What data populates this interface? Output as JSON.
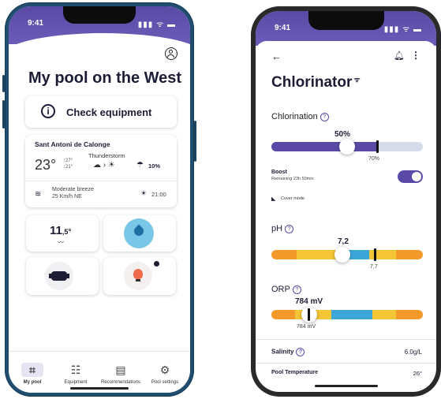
{
  "left_phone": {
    "status": {
      "time": "9:41",
      "icons": "▮▮▮ ᯤ ▬"
    },
    "pool_title": "My pool on the West",
    "check_equipment": "Check equipment",
    "weather": {
      "location": "Sant Antoni de Calonge",
      "temp": "23°",
      "temp_high": "↑27°",
      "temp_low": "↓21°",
      "condition": "Thunderstorm",
      "rain_chance": "10%",
      "wind_line1": "Moderate breeze",
      "wind_line2": "25 Km/h NE",
      "sunset": "21:00"
    },
    "tiles": {
      "water_temp_main": "11",
      "water_temp_dec": ",5",
      "water_temp_deg": "°"
    },
    "tabs": [
      {
        "label": "My pool",
        "icon": "pool-icon"
      },
      {
        "label": "Equipment",
        "icon": "equipment-icon"
      },
      {
        "label": "Recommendations",
        "icon": "recommendations-icon"
      },
      {
        "label": "Pool settings",
        "icon": "settings-icon"
      }
    ]
  },
  "right_phone": {
    "status": {
      "time": "9:41",
      "icons": "▮▮▮ ᯤ ▬"
    },
    "title": "Chlorinator",
    "chlorination": {
      "label": "Chlorination",
      "value": "50%",
      "target": "70%",
      "value_fraction": 0.5,
      "target_fraction": 0.7
    },
    "boost": {
      "label": "Boost",
      "remaining": "Remaining 23h 50min",
      "enabled": true
    },
    "cover_mode": "Cover mode",
    "ph": {
      "label": "pH",
      "value": "7,2",
      "target": "7,7"
    },
    "orp": {
      "label": "ORP",
      "value": "784 mV",
      "target": "784 mV"
    },
    "salinity": {
      "label": "Salinity",
      "value": "6.0g/L"
    },
    "pool_temperature": {
      "label": "Pool Temperature",
      "value": "26°"
    }
  },
  "colors": {
    "accent": "#5a4aa6",
    "orange": "#f39a2b",
    "yellow": "#f4c534",
    "blue": "#3ba6d8",
    "left_frame": "#1f4e6f"
  }
}
